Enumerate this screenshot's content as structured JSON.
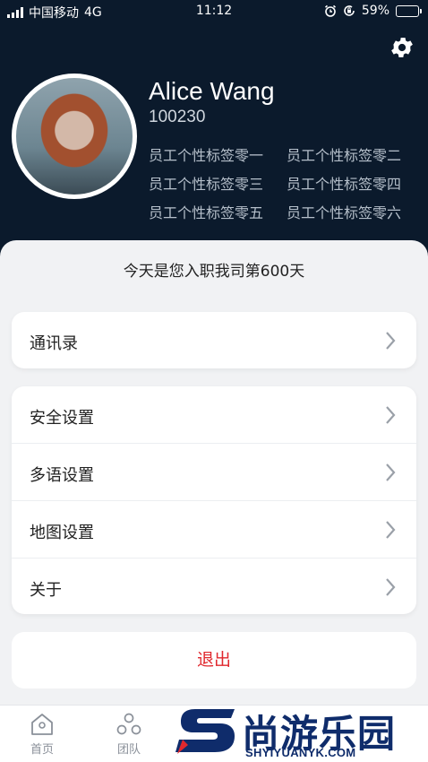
{
  "status_bar": {
    "carrier": "中国移动",
    "network": "4G",
    "time": "11:12",
    "battery": "59%",
    "battery_level": 0.59
  },
  "profile": {
    "name": "Alice Wang",
    "employee_id": "100230",
    "tags": [
      "员工个性标签零一",
      "员工个性标签零二",
      "员工个性标签零三",
      "员工个性标签零四",
      "员工个性标签零五",
      "员工个性标签零六"
    ]
  },
  "tenure_text": "今天是您入职我司第600天",
  "menu": {
    "contacts": "通讯录",
    "security": "安全设置",
    "language": "多语设置",
    "map": "地图设置",
    "about": "关于"
  },
  "logout_label": "退出",
  "tabbar": {
    "home": "首页",
    "team": "团队"
  },
  "watermark": {
    "name": "尚游乐园",
    "url": "SHYIYUANYK.COM"
  },
  "colors": {
    "header_bg": "#0b1a2c",
    "logout": "#e0282e",
    "page_bg": "#f1f2f4",
    "watermark": "#0f2c6b"
  },
  "icons": [
    "signal-icon",
    "alarm-icon",
    "orientation-lock-icon",
    "battery-icon",
    "gear-icon",
    "chevron-right-icon",
    "home-icon",
    "team-icon"
  ]
}
